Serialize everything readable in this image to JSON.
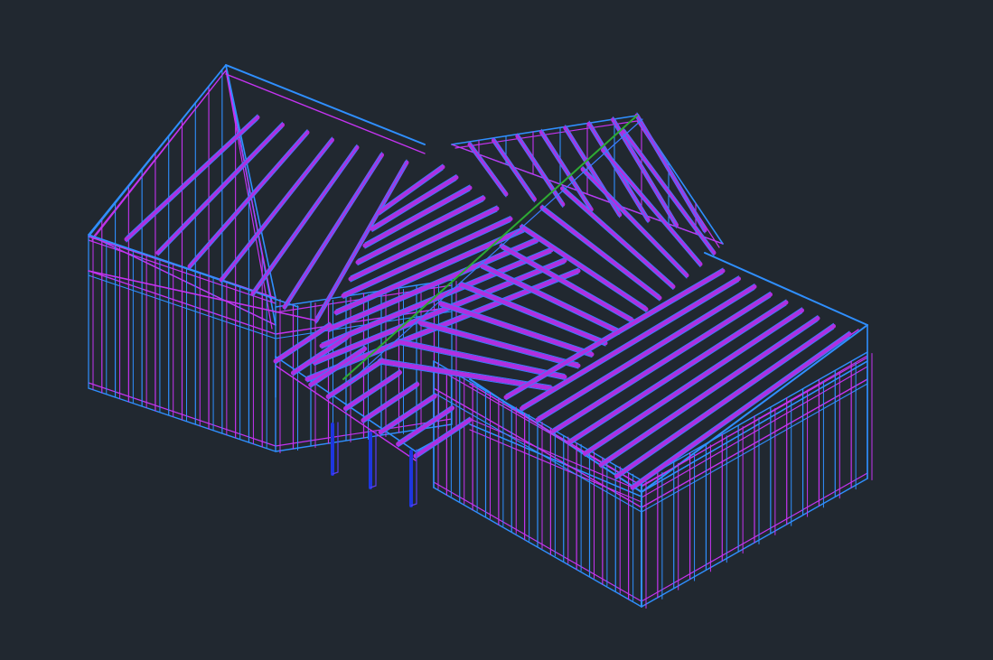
{
  "canvas": {
    "background": "#212830"
  },
  "model": {
    "colors": {
      "wall_outer": "#2f8fff",
      "wall_inner": "#c433f0",
      "rafter": "#b02fe0",
      "rafter_edge": "#3a7cff",
      "ridge": "#2eaa33",
      "post": "#1d36e0",
      "post_edge": "#5a3df0"
    }
  }
}
